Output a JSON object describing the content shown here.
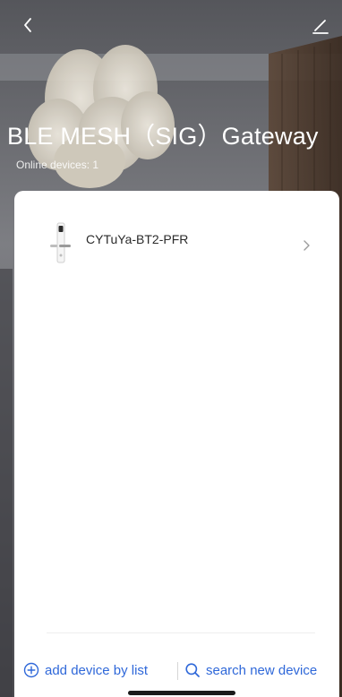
{
  "header": {
    "title": "BLE MESH（SIG）Gateway",
    "online_devices": "Online devices: 1"
  },
  "devices": [
    {
      "name": "CYTuYa-BT2-PFR",
      "icon": "smart-lock-icon"
    }
  ],
  "footer": {
    "add_by_list": "add device by list",
    "search_new": "search new device"
  },
  "icons": {
    "back": "chevron-left-icon",
    "edit": "pencil-icon",
    "row": "chevron-right-icon",
    "add": "plus-circle-icon",
    "search": "search-icon"
  },
  "colors": {
    "accent": "#2f68d9",
    "card": "#ffffff",
    "title": "#ffffff"
  }
}
